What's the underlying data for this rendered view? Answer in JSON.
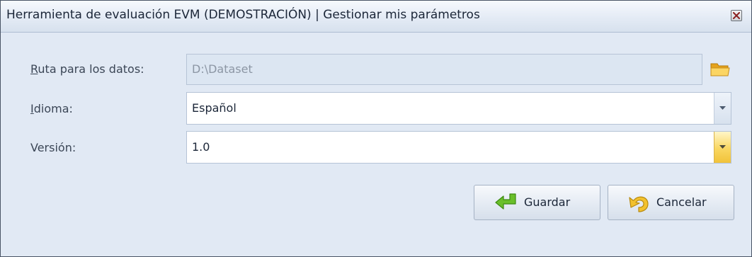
{
  "window": {
    "title": "Herramienta de evaluación EVM (DEMOSTRACIÓN) | Gestionar mis parámetros",
    "close_icon": "close-icon"
  },
  "form": {
    "data_path": {
      "label_accel": "R",
      "label_rest": "uta para los datos:",
      "value": "D:\\Dataset",
      "browse_icon": "folder-icon"
    },
    "language": {
      "label_accel": "I",
      "label_rest": "dioma:",
      "value": "Español"
    },
    "version": {
      "label": "Versión:",
      "value": "1.0"
    }
  },
  "buttons": {
    "save_label": "Guardar",
    "cancel_label": "Cancelar"
  },
  "colors": {
    "window_bg": "#e1e9f4",
    "highlight_arrow": "#f9d660",
    "save_icon": "#6abf2a",
    "cancel_icon": "#f2c12e"
  }
}
